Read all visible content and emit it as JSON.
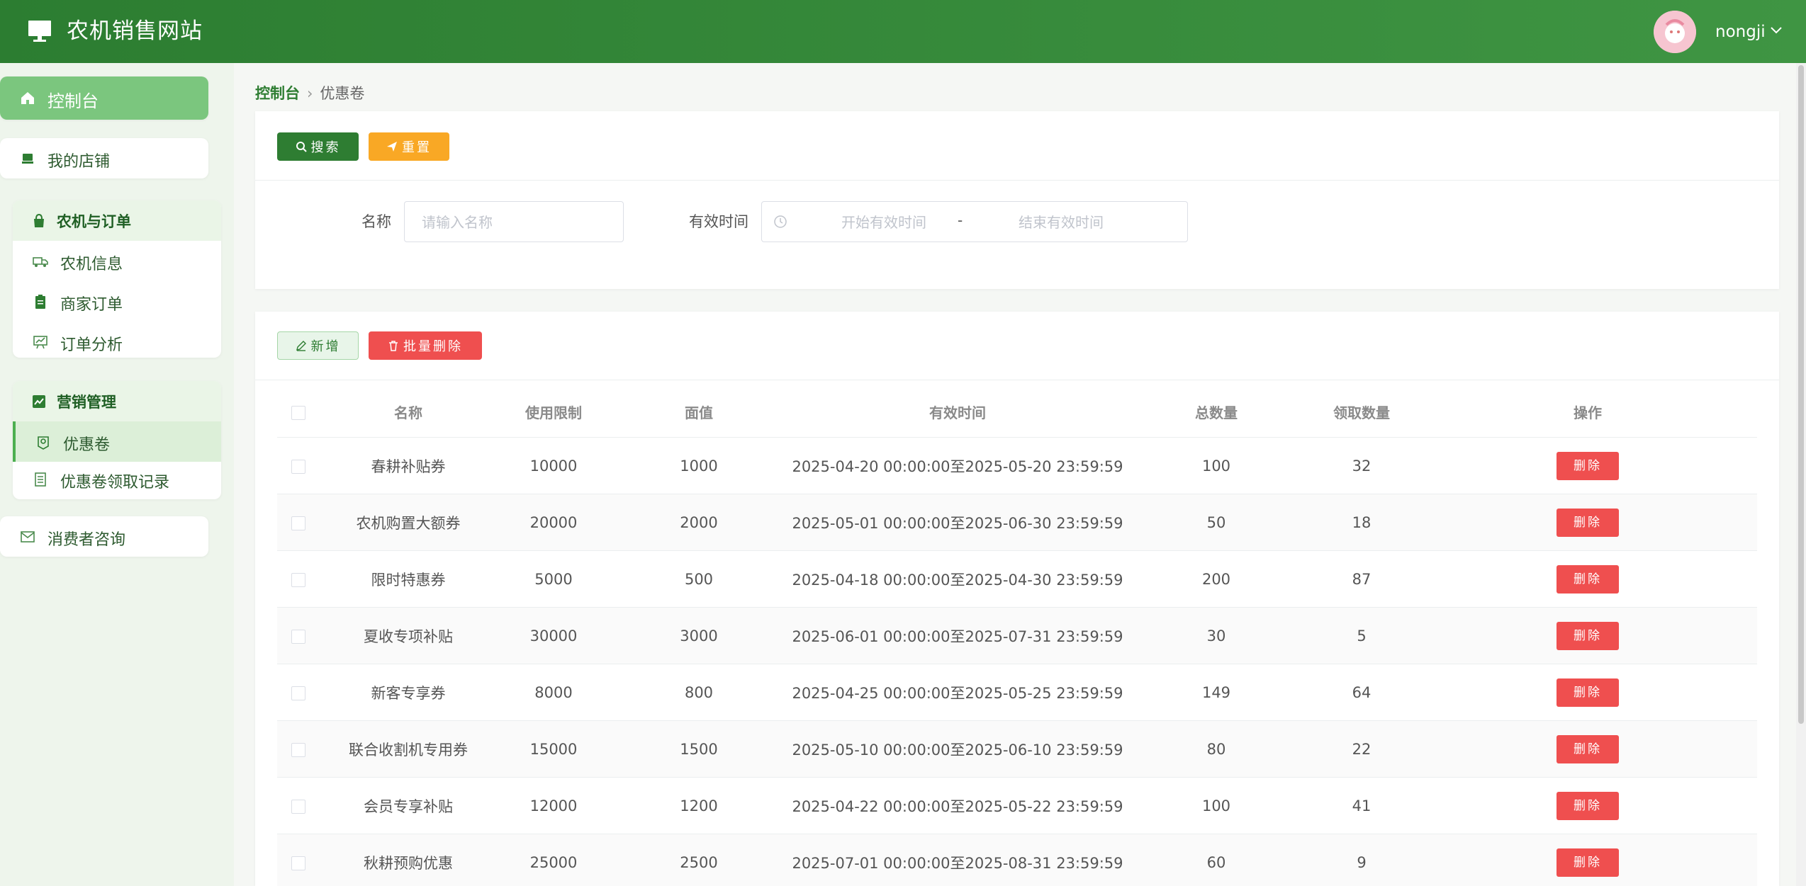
{
  "header": {
    "title": "农机销售网站",
    "username": "nongji"
  },
  "sidebar": {
    "dashboard": "控制台",
    "my_shop": "我的店铺",
    "group_orders": {
      "title": "农机与订单",
      "items": [
        "农机信息",
        "商家订单",
        "订单分析"
      ]
    },
    "group_marketing": {
      "title": "营销管理",
      "items": [
        "优惠卷",
        "优惠卷领取记录"
      ]
    },
    "consult": "消费者咨询"
  },
  "breadcrumb": {
    "home": "控制台",
    "current": "优惠卷"
  },
  "search": {
    "search_btn": "搜索",
    "reset_btn": "重置",
    "name_label": "名称",
    "name_placeholder": "请输入名称",
    "time_label": "有效时间",
    "start_placeholder": "开始有效时间",
    "range_sep": "-",
    "end_placeholder": "结束有效时间"
  },
  "toolbar": {
    "add_btn": "新增",
    "bulk_delete_btn": "批量删除"
  },
  "table": {
    "headers": [
      "名称",
      "使用限制",
      "面值",
      "有效时间",
      "总数量",
      "领取数量",
      "操作"
    ],
    "delete_label": "删除",
    "rows": [
      {
        "name": "春耕补贴券",
        "limit": "10000",
        "value": "1000",
        "period": "2025-04-20 00:00:00至2025-05-20 23:59:59",
        "total": "100",
        "claimed": "32"
      },
      {
        "name": "农机购置大额券",
        "limit": "20000",
        "value": "2000",
        "period": "2025-05-01 00:00:00至2025-06-30 23:59:59",
        "total": "50",
        "claimed": "18"
      },
      {
        "name": "限时特惠券",
        "limit": "5000",
        "value": "500",
        "period": "2025-04-18 00:00:00至2025-04-30 23:59:59",
        "total": "200",
        "claimed": "87"
      },
      {
        "name": "夏收专项补贴",
        "limit": "30000",
        "value": "3000",
        "period": "2025-06-01 00:00:00至2025-07-31 23:59:59",
        "total": "30",
        "claimed": "5"
      },
      {
        "name": "新客专享券",
        "limit": "8000",
        "value": "800",
        "period": "2025-04-25 00:00:00至2025-05-25 23:59:59",
        "total": "149",
        "claimed": "64"
      },
      {
        "name": "联合收割机专用券",
        "limit": "15000",
        "value": "1500",
        "period": "2025-05-10 00:00:00至2025-06-10 23:59:59",
        "total": "80",
        "claimed": "22"
      },
      {
        "name": "会员专享补贴",
        "limit": "12000",
        "value": "1200",
        "period": "2025-04-22 00:00:00至2025-05-22 23:59:59",
        "total": "100",
        "claimed": "41"
      },
      {
        "name": "秋耕预购优惠",
        "limit": "25000",
        "value": "2500",
        "period": "2025-07-01 00:00:00至2025-08-31 23:59:59",
        "total": "60",
        "claimed": "9"
      }
    ]
  },
  "colors": {
    "primary": "#2e7d32",
    "header": "#3a8f3e",
    "danger": "#ef4f4f",
    "warning": "#f9a825"
  }
}
